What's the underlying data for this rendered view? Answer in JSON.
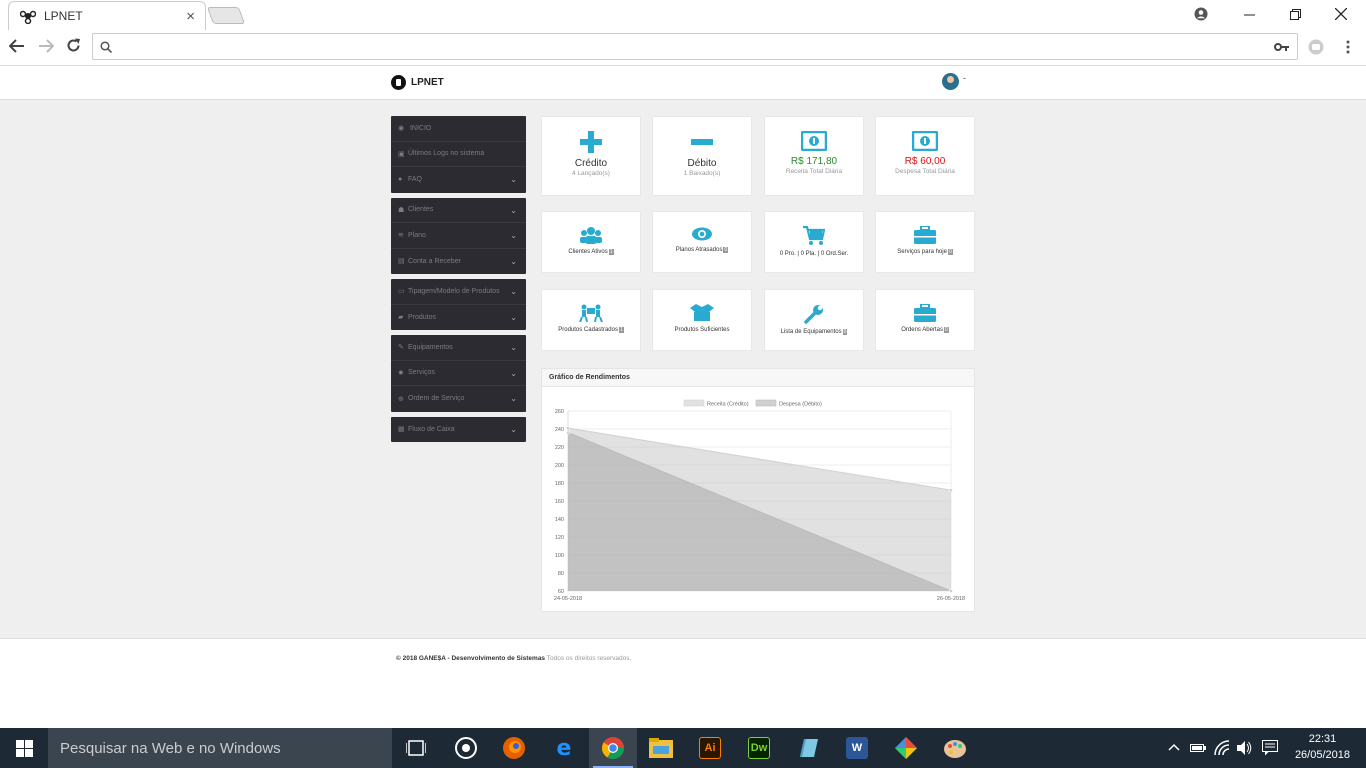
{
  "browser": {
    "tab_title": "LPNET",
    "url": "",
    "close": "×"
  },
  "header": {
    "brand": "LPNET",
    "user_dash": "-"
  },
  "sidebar": {
    "groups": [
      {
        "items": [
          {
            "label": "INICIO",
            "icon": "dashboard-icon"
          },
          {
            "label": "Últimos Logs no sistema",
            "icon": "lock-icon"
          },
          {
            "label": "FAQ",
            "icon": "question-icon",
            "chevron": true
          }
        ]
      },
      {
        "items": [
          {
            "label": "Clientes",
            "icon": "users-icon",
            "chevron": true
          },
          {
            "label": "Plano",
            "icon": "wifi-icon",
            "chevron": true
          },
          {
            "label": "Conta a Receber",
            "icon": "calendar-icon",
            "chevron": true
          }
        ]
      },
      {
        "items": [
          {
            "label": "Tipagem/Modelo de Produtos",
            "icon": "keyboard-icon",
            "chevron": true
          },
          {
            "label": "Produtos",
            "icon": "truck-icon",
            "chevron": true
          }
        ]
      },
      {
        "items": [
          {
            "label": "Equipamentos",
            "icon": "wrench-icon",
            "chevron": true
          },
          {
            "label": "Serviços",
            "icon": "gear-icon",
            "chevron": true
          },
          {
            "label": "Ordem de Serviço",
            "icon": "globe-icon",
            "chevron": true
          }
        ]
      },
      {
        "items": [
          {
            "label": "Fluxo de Caixa",
            "icon": "calculator-icon",
            "chevron": true
          }
        ]
      }
    ]
  },
  "cards": {
    "credito": {
      "title": "Crédito",
      "sub": "4 Lançado(s)"
    },
    "debito": {
      "title": "Débito",
      "sub": "1 Baixado(s)"
    },
    "receita": {
      "title": "R$ 171,80",
      "sub": "Receita Total Diária"
    },
    "despesa": {
      "title": "R$ 60,00",
      "sub": "Despesa Total Diária"
    },
    "clientes": {
      "label": "Clientes Ativos",
      "badge": "1"
    },
    "planos": {
      "label": "Planos Atrasados",
      "badge": "0"
    },
    "pro": {
      "label": "0 Pro. | 0 Pla. | 0 Ord.Ser."
    },
    "servicos": {
      "label": "Serviços para hoje",
      "badge": "0"
    },
    "produtos": {
      "label": "Produtos Cadastrados",
      "badge": "1"
    },
    "suficientes": {
      "label": "Produtos Suficientes"
    },
    "equipamentos": {
      "label": "Lista de Equipamentos",
      "badge": "0"
    },
    "ordens": {
      "label": "Ordens Abertas",
      "badge": "0"
    }
  },
  "chart_title": "Gráfico de Rendimentos",
  "chart_data": {
    "type": "area",
    "x": [
      "24-05-2018",
      "26-05-2018"
    ],
    "series": [
      {
        "name": "Receita (Crédito)",
        "values": [
          241,
          172
        ]
      },
      {
        "name": "Despesa (Débito)",
        "values": [
          236,
          60
        ]
      }
    ],
    "ylim": [
      60,
      260
    ],
    "yticks": [
      60,
      80,
      100,
      120,
      140,
      160,
      180,
      200,
      220,
      240,
      260
    ],
    "legend": "top-center",
    "grid": true
  },
  "footer": {
    "copyright": "© 2018 GANE$A - Desenvolvimento de Sistemas",
    "rights": "Todos os direitos reservados."
  },
  "taskbar": {
    "search_placeholder": "Pesquisar na Web e no Windows",
    "time": "22:31",
    "date": "26/05/2018"
  }
}
